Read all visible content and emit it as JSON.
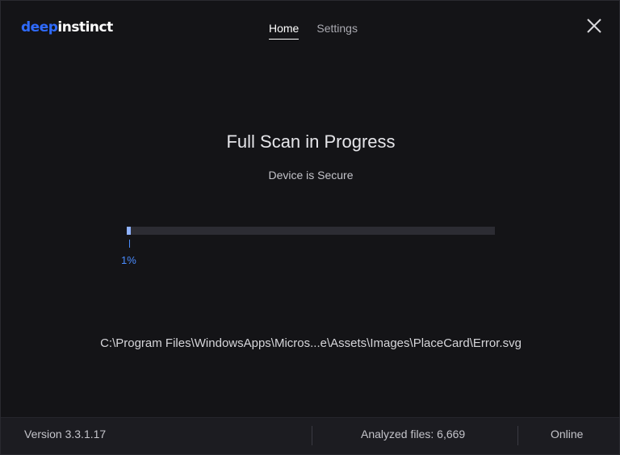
{
  "header": {
    "logo": {
      "part1": "deep",
      "part2": "instinct"
    },
    "tabs": [
      {
        "label": "Home",
        "active": true
      },
      {
        "label": "Settings",
        "active": false
      }
    ],
    "close_icon": "close-icon"
  },
  "main": {
    "title": "Full Scan in Progress",
    "subtitle": "Device is Secure",
    "progress": {
      "percent": 1,
      "label": "1%"
    },
    "current_file": "C:\\Program Files\\WindowsApps\\Micros...e\\Assets\\Images\\PlaceCard\\Error.svg"
  },
  "footer": {
    "version": "Version 3.3.1.17",
    "analyzed_files": "Analyzed files: 6,669",
    "status": "Online"
  },
  "colors": {
    "background": "#141417",
    "accent": "#4a8cff",
    "logo_blue": "#2f6bff",
    "footer_bg": "#1c1c21"
  }
}
